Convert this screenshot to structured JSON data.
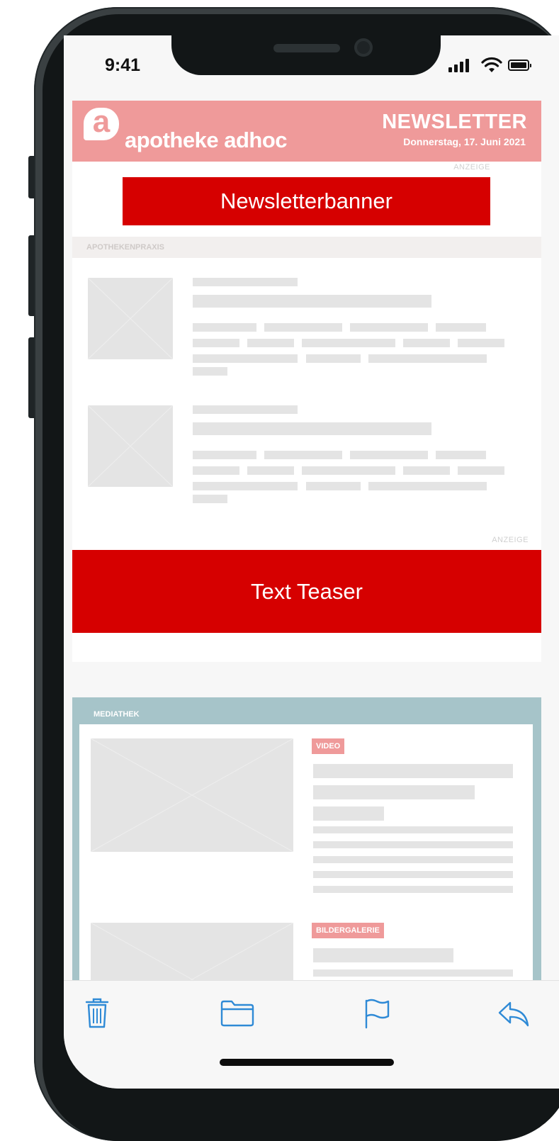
{
  "status_bar": {
    "time": "9:41"
  },
  "header": {
    "logo_letter": "a",
    "logo_text": "apotheke adhoc",
    "title": "NEWSLETTER",
    "date": "Donnerstag, 17. Juni 2021",
    "brand_color": "#ef9a9a"
  },
  "ads": {
    "label_1": "ANZEIGE",
    "banner": "Newsletterbanner",
    "label_2": "ANZEIGE",
    "teaser": "Text Teaser",
    "ad_color": "#d60000"
  },
  "sections": {
    "apothekenpraxis": "APOTHEKENPRAXIS",
    "mediathek": "MEDIATHEK"
  },
  "media": {
    "tag_video": "VIDEO",
    "tag_gallery": "BILDERGALERIE",
    "panel_color": "#a6c4c9"
  },
  "toolbar": {
    "icons": [
      "trash-icon",
      "folder-icon",
      "flag-icon",
      "reply-icon"
    ],
    "accent": "#2f8ad6"
  }
}
